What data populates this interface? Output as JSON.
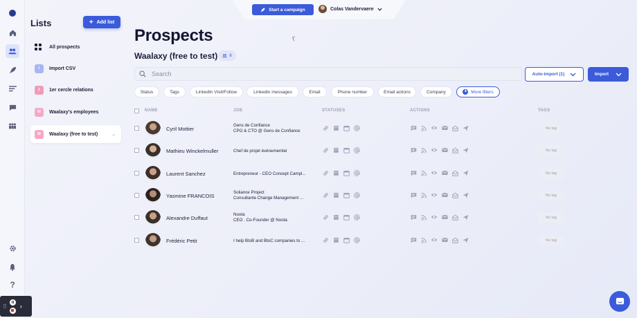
{
  "colors": {
    "accent": "#3b5bdb",
    "muted": "#9aa0b8"
  },
  "rail": {
    "icons": [
      "logo-icon",
      "home-icon",
      "users-icon",
      "rocket-icon",
      "list-icon",
      "chat-icon",
      "team-icon",
      "settings-icon",
      "bell-icon",
      "help-icon"
    ]
  },
  "lists": {
    "title": "Lists",
    "add_button": "Add list",
    "items": [
      {
        "label": "All prospects",
        "badge": ""
      },
      {
        "label": "Import CSV",
        "badge": "I",
        "color": "#a9b6f0"
      },
      {
        "label": "1er cercle relations",
        "badge": "1",
        "color": "#f09bb9"
      },
      {
        "label": "Waalaxy's employees",
        "badge": "W",
        "color": "#f5a9c7"
      },
      {
        "label": "Waalaxy (free to test)",
        "badge": "W",
        "color": "#f5a9c7"
      }
    ]
  },
  "header": {
    "campaign_button": "Start a campaign",
    "user_name": "Colas Vandervaere"
  },
  "main": {
    "title": "Prospects",
    "subtitle": "Waalaxy (free to test)",
    "count": "6",
    "search_placeholder": "Search",
    "auto_import": "Auto-import (1)",
    "import": "Import",
    "filters": [
      "Status",
      "Tags",
      "LinkedIn Visit/Follow",
      "Linkedin messages",
      "Email",
      "Phone number",
      "Email actions",
      "Company",
      "More filters"
    ]
  },
  "table": {
    "headers": {
      "name": "NAME",
      "job": "JOB",
      "statuses": "STATUSES",
      "actions": "ACTIONS",
      "tags": "TAGS"
    },
    "rows": [
      {
        "name": "Cyril Mottier",
        "job1": "Gens de Confiance",
        "job2": "CPO & CTO @ Gens de Confiance",
        "tag": "No tag"
      },
      {
        "name": "Mathieu Winckelmuller",
        "job1": "Chef de projet événementiel",
        "job2": "",
        "tag": "No tag"
      },
      {
        "name": "Laurent Sanchez",
        "job1": "Entrepreneur - CEO Concept Campi...",
        "job2": "",
        "tag": "No tag"
      },
      {
        "name": "Yasmine FRANCOIS",
        "job1": "Soliance Project",
        "job2": "Consultante Change Management ...",
        "tag": "No tag"
      },
      {
        "name": "Alexandre Duffaut",
        "job1": "Noota",
        "job2": "CEO . Co-Founder @ Noota",
        "tag": "No tag"
      },
      {
        "name": "Frédéric Petit",
        "job1": "I help BtoB and BtoC companies to ...",
        "job2": "",
        "tag": "No tag"
      }
    ]
  }
}
